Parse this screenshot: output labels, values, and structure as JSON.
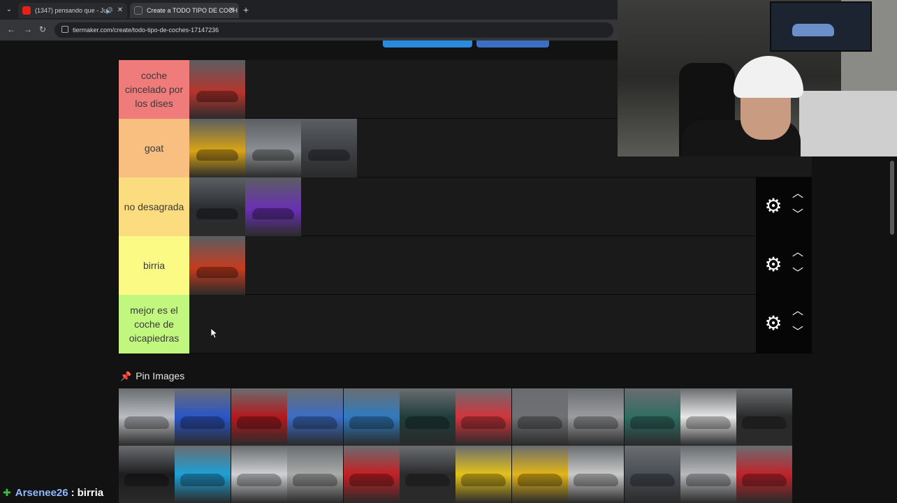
{
  "browser": {
    "tabs": [
      {
        "title": "(1347) pensando que - Ju",
        "active": false
      },
      {
        "title": "Create a TODO TIPO DE COCH",
        "active": true
      }
    ],
    "url": "tiermaker.com/create/todo-tipo-de-coches-17147236"
  },
  "tiers": [
    {
      "label": "coche cincelado por los dises",
      "color": "#f07b7b",
      "items": [
        {
          "color": "#b8342c"
        }
      ]
    },
    {
      "label": "goat",
      "color": "#f9bf80",
      "items": [
        {
          "color": "#d9a414"
        },
        {
          "color": "#8c8f93"
        },
        {
          "color": "#3d3f44"
        }
      ]
    },
    {
      "label": "no desagrada",
      "color": "#fbdd80",
      "items": [
        {
          "color": "#2a2c30"
        },
        {
          "color": "#6a2fb5"
        }
      ]
    },
    {
      "label": "birria",
      "color": "#fafa84",
      "items": [
        {
          "color": "#c73b1e"
        }
      ]
    },
    {
      "label": "mejor es el coche de oicapiedras",
      "color": "#c2f77f",
      "items": []
    }
  ],
  "controls": {
    "gear": "⚙",
    "up": "︿",
    "down": "﹀"
  },
  "pin": {
    "title": "Pin Images"
  },
  "pin_images": [
    {
      "color": "#b9bcc0"
    },
    {
      "color": "#2a55c9"
    },
    {
      "color": "#b3181c"
    },
    {
      "color": "#3b6dc7"
    },
    {
      "color": "#2f7bc0"
    },
    {
      "color": "#1f3d3a"
    },
    {
      "color": "#d2343b"
    },
    {
      "color": "#6f7073"
    },
    {
      "color": "#9b9c9e"
    },
    {
      "color": "#2f6d62"
    },
    {
      "color": "#e8e8e8"
    },
    {
      "color": "#2a2a2a"
    },
    {
      "color": "#1d1d1f"
    },
    {
      "color": "#1da0d6"
    },
    {
      "color": "#cfd1d4"
    },
    {
      "color": "#a9aba9"
    },
    {
      "color": "#c51f24"
    },
    {
      "color": "#2b2b2c"
    },
    {
      "color": "#e5c21a"
    },
    {
      "color": "#e3b517"
    },
    {
      "color": "#c9c9c9"
    },
    {
      "color": "#4a4f55"
    },
    {
      "color": "#b7b9bb"
    },
    {
      "color": "#c0232a"
    }
  ],
  "chat": {
    "user": "Arsenee26",
    "separator": ":",
    "message": "birria"
  }
}
